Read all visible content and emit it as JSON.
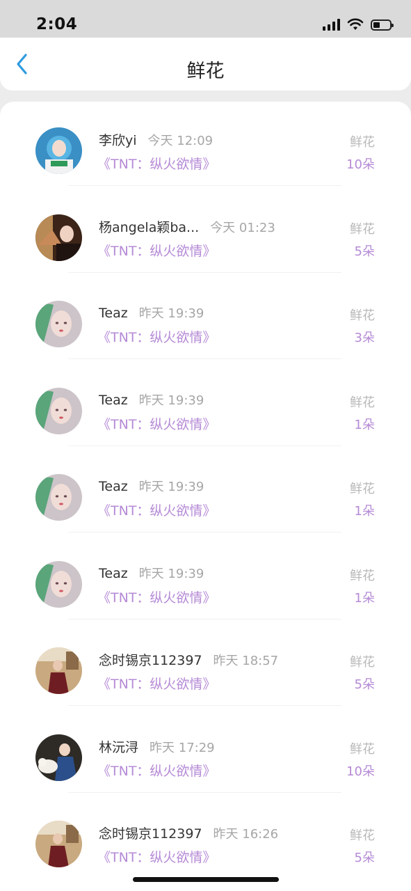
{
  "status_bar": {
    "time": "2:04"
  },
  "header": {
    "title": "鲜花"
  },
  "gift_items": [
    {
      "name": "李欣yi",
      "time": "今天 12:09",
      "book": "《TNT：纵火欲情》",
      "gift_label": "鲜花",
      "gift_count": "10朵",
      "avatar": "blue-hair-girl"
    },
    {
      "name": "杨angela颖ba...",
      "time": "今天 01:23",
      "book": "《TNT：纵火欲情》",
      "gift_label": "鲜花",
      "gift_count": "5朵",
      "avatar": "fan-girl"
    },
    {
      "name": "Teaz",
      "time": "昨天 19:39",
      "book": "《TNT：纵火欲情》",
      "gift_label": "鲜花",
      "gift_count": "3朵",
      "avatar": "painted-girl"
    },
    {
      "name": "Teaz",
      "time": "昨天 19:39",
      "book": "《TNT：纵火欲情》",
      "gift_label": "鲜花",
      "gift_count": "1朵",
      "avatar": "painted-girl"
    },
    {
      "name": "Teaz",
      "time": "昨天 19:39",
      "book": "《TNT：纵火欲情》",
      "gift_label": "鲜花",
      "gift_count": "1朵",
      "avatar": "painted-girl"
    },
    {
      "name": "Teaz",
      "time": "昨天 19:39",
      "book": "《TNT：纵火欲情》",
      "gift_label": "鲜花",
      "gift_count": "1朵",
      "avatar": "painted-girl"
    },
    {
      "name": "念时锡京112397",
      "time": "昨天 18:57",
      "book": "《TNT：纵火欲情》",
      "gift_label": "鲜花",
      "gift_count": "5朵",
      "avatar": "room-photo"
    },
    {
      "name": "林沅浔",
      "time": "昨天 17:29",
      "book": "《TNT：纵火欲情》",
      "gift_label": "鲜花",
      "gift_count": "10朵",
      "avatar": "girl-with-dog"
    },
    {
      "name": "念时锡京112397",
      "time": "昨天 16:26",
      "book": "《TNT：纵火欲情》",
      "gift_label": "鲜花",
      "gift_count": "5朵",
      "avatar": "room-photo"
    }
  ],
  "colors": {
    "accent_purple": "#b58ad6",
    "back_blue": "#2f9be0",
    "muted_gray": "#a6a6a6"
  }
}
